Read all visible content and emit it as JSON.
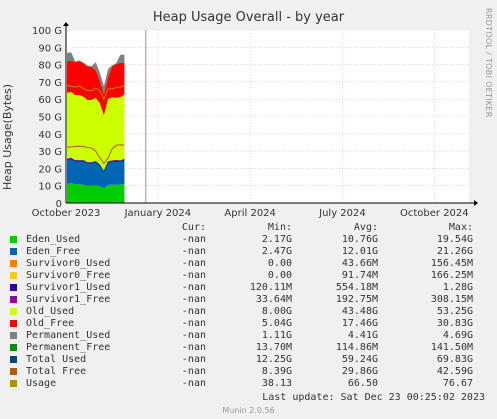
{
  "title": "Heap Usage Overall - by year",
  "side_label": "RRDTOOL / TOBI OETIKER",
  "footer": {
    "last_update": "Last update: Sat Dec 23 00:25:02 2023",
    "munin": "Munin 2.0.56"
  },
  "legend_headers": {
    "cur": "Cur:",
    "min": "Min:",
    "avg": "Avg:",
    "max": "Max:"
  },
  "legend": [
    {
      "name": "Eden_Used",
      "color": "#00cc00",
      "cur": "-nan",
      "min": "2.17G",
      "avg": "10.76G",
      "max": "19.54G"
    },
    {
      "name": "Eden_Free",
      "color": "#0066b3",
      "cur": "-nan",
      "min": "2.47G",
      "avg": "12.01G",
      "max": "21.26G"
    },
    {
      "name": "Survivor0_Used",
      "color": "#ff8000",
      "cur": "-nan",
      "min": "0.00",
      "avg": "43.66M",
      "max": "156.45M"
    },
    {
      "name": "Survivor0_Free",
      "color": "#ffcc00",
      "cur": "-nan",
      "min": "0.00",
      "avg": "91.74M",
      "max": "166.25M"
    },
    {
      "name": "Survivor1_Used",
      "color": "#330099",
      "cur": "-nan",
      "min": "120.11M",
      "avg": "554.18M",
      "max": "1.28G"
    },
    {
      "name": "Survivor1_Free",
      "color": "#990099",
      "cur": "-nan",
      "min": "33.64M",
      "avg": "192.75M",
      "max": "308.15M"
    },
    {
      "name": "Old_Used",
      "color": "#ccff00",
      "cur": "-nan",
      "min": "8.00G",
      "avg": "43.48G",
      "max": "53.25G"
    },
    {
      "name": "Old_Free",
      "color": "#ff0000",
      "cur": "-nan",
      "min": "5.04G",
      "avg": "17.46G",
      "max": "30.83G"
    },
    {
      "name": "Permanent_Used",
      "color": "#808080",
      "cur": "-nan",
      "min": "1.11G",
      "avg": "4.41G",
      "max": "4.69G"
    },
    {
      "name": "Permanent_Free",
      "color": "#008f00",
      "cur": "-nan",
      "min": "13.70M",
      "avg": "114.86M",
      "max": "141.50M"
    },
    {
      "name": "Total Used",
      "color": "#00487d",
      "cur": "-nan",
      "min": "12.25G",
      "avg": "59.24G",
      "max": "69.83G"
    },
    {
      "name": "Total Free",
      "color": "#b35a00",
      "cur": "-nan",
      "min": "8.39G",
      "avg": "29.86G",
      "max": "42.59G"
    },
    {
      "name": "Usage",
      "color": "#b38f00",
      "cur": "-nan",
      "min": "38.13",
      "avg": "66.50",
      "max": "76.67"
    }
  ],
  "chart_data": {
    "type": "area",
    "title": "Heap Usage Overall - by year",
    "ylabel": "Heap Usage(Bytes)",
    "ylim": [
      0,
      100
    ],
    "y_unit": "G",
    "yticks": [
      "0",
      "10 G",
      "20 G",
      "30 G",
      "40 G",
      "50 G",
      "60 G",
      "70 G",
      "80 G",
      "90 G",
      "100 G"
    ],
    "xticks": [
      "October 2023",
      "January 2024",
      "April 2024",
      "July 2024",
      "October 2024"
    ],
    "xtick_positions": [
      0.0,
      0.228,
      0.457,
      0.686,
      0.914
    ],
    "grid": true,
    "data_end_fraction": 0.145,
    "now_fraction": 0.198,
    "series": [
      {
        "name": "Eden_Used",
        "color": "#00cc00",
        "values": [
          11.2,
          11.5,
          10.8,
          11.0,
          10.5,
          9.8,
          10.0,
          10.2,
          9.6,
          8.5,
          10.4,
          10.6,
          10.5,
          10.8,
          11.0
        ]
      },
      {
        "name": "Eden_Free",
        "color": "#0066b3",
        "values": [
          13.5,
          13.8,
          13.2,
          13.0,
          13.5,
          13.0,
          12.8,
          13.2,
          12.0,
          9.5,
          13.0,
          13.2,
          13.4,
          13.1,
          13.6
        ]
      },
      {
        "name": "Survivor0_Used",
        "color": "#ff8000",
        "values": [
          0.05,
          0.05,
          0.04,
          0.04,
          0.05,
          0.04,
          0.04,
          0.04,
          0.04,
          0.03,
          0.04,
          0.04,
          0.05,
          0.04,
          0.05
        ]
      },
      {
        "name": "Survivor0_Free",
        "color": "#ffcc00",
        "values": [
          0.1,
          0.1,
          0.09,
          0.09,
          0.1,
          0.09,
          0.09,
          0.09,
          0.09,
          0.08,
          0.09,
          0.09,
          0.1,
          0.09,
          0.1
        ]
      },
      {
        "name": "Survivor1_Used",
        "color": "#330099",
        "values": [
          0.6,
          0.55,
          0.5,
          0.6,
          0.55,
          0.5,
          0.5,
          0.6,
          0.5,
          0.4,
          0.5,
          0.55,
          0.6,
          0.5,
          0.6
        ]
      },
      {
        "name": "Survivor1_Free",
        "color": "#990099",
        "values": [
          0.2,
          0.2,
          0.2,
          0.2,
          0.2,
          0.2,
          0.2,
          0.2,
          0.2,
          0.15,
          0.2,
          0.2,
          0.2,
          0.2,
          0.2
        ]
      },
      {
        "name": "Old_Used",
        "color": "#ccff00",
        "values": [
          38.0,
          38.0,
          37.5,
          37.5,
          36.5,
          35.8,
          36.0,
          36.4,
          35.3,
          32.0,
          36.0,
          36.4,
          36.0,
          36.5,
          37.0
        ]
      },
      {
        "name": "Old_Free",
        "color": "#ff0000",
        "values": [
          18.3,
          18.2,
          19.0,
          19.5,
          19.3,
          19.5,
          19.0,
          16.0,
          13.0,
          12.3,
          12.5,
          18.0,
          19.5,
          19.8,
          18.4
        ]
      },
      {
        "name": "Permanent_Used",
        "color": "#808080",
        "values": [
          4.6,
          4.6,
          0.4,
          0.4,
          0.4,
          0.4,
          0.4,
          4.5,
          4.6,
          4.6,
          4.6,
          0.4,
          0.4,
          4.5,
          4.6
        ]
      },
      {
        "name": "Permanent_Free",
        "color": "#008f00",
        "values": [
          0.12,
          0.12,
          0.12,
          0.12,
          0.12,
          0.12,
          0.12,
          0.12,
          0.12,
          0.1,
          0.12,
          0.12,
          0.12,
          0.12,
          0.12
        ]
      }
    ],
    "lines": [
      {
        "name": "Total Used",
        "color": "#00487d",
        "values": [
          24.8,
          25.2,
          24.1,
          24.2,
          24.2,
          23.0,
          22.9,
          23.5,
          21.7,
          18.1,
          23.5,
          23.9,
          24.0,
          24.0,
          24.7
        ]
      },
      {
        "name": "Total Free",
        "color": "#b35a00",
        "values": [
          32.3,
          32.4,
          32.7,
          32.8,
          32.7,
          32.1,
          31.8,
          29.9,
          26.1,
          22.8,
          25.8,
          31.3,
          33.3,
          33.7,
          33.3
        ]
      },
      {
        "name": "Usage",
        "color": "#b38f00",
        "values": [
          68.0,
          67.5,
          67.0,
          67.8,
          66.0,
          65.0,
          64.8,
          66.5,
          65.0,
          60.0,
          66.0,
          66.0,
          66.8,
          67.0,
          68.0
        ]
      }
    ]
  }
}
